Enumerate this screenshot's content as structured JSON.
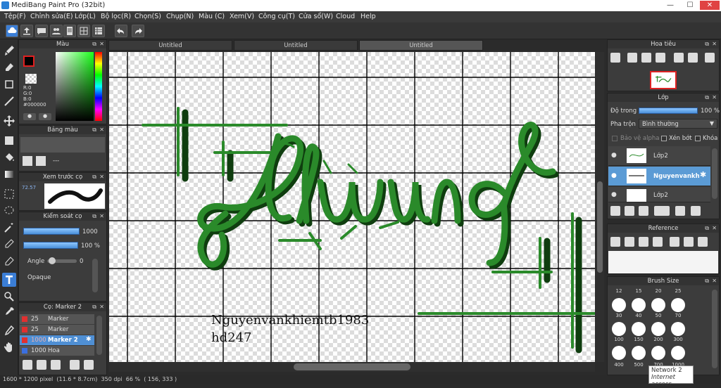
{
  "window": {
    "title": "MediBang Paint Pro (32bit)",
    "min": "—",
    "max": "☐",
    "close": "✕"
  },
  "menu": [
    "Tệp(F)",
    "Chỉnh sửa(E)",
    "Lớp(L)",
    "Bộ lọc(R)",
    "Chọn(S)",
    "Chụp(N)",
    "Màu (C)",
    "Xem(V)",
    "Công cụ(T)",
    "Cửa sổ(W)",
    "Cloud",
    "Help"
  ],
  "tabs": [
    "Untitled",
    "Untitled",
    "Untitled"
  ],
  "color_panel": {
    "title": "Màu",
    "r": "R:0",
    "g": "G:0",
    "b": "B:0",
    "hex": "#000000",
    "primary": "#000000",
    "secondary": "#ffffff"
  },
  "palette_panel": {
    "title": "Bảng màu",
    "empty": "---"
  },
  "preview_panel": {
    "title": "Xem trước cọ",
    "zoom": "72.57"
  },
  "brush_ctrl": {
    "title": "Kiểm soát cọ",
    "width_val": "1000",
    "opacity_val": "100 %",
    "angle_label": "Angle",
    "angle_val": "0",
    "opaque_label": "Opaque"
  },
  "brush_list": {
    "title": "Cọ: Marker 2",
    "items": [
      {
        "size": "25",
        "name": "Marker",
        "color": "#e03030"
      },
      {
        "size": "25",
        "name": "Marker",
        "color": "#e03030"
      },
      {
        "size": "1000",
        "name": "Marker 2",
        "color": "#e03030"
      },
      {
        "size": "1000",
        "name": "Hoa",
        "color": "#3a6fe0"
      }
    ]
  },
  "navigator": {
    "title": "Hoa tiêu"
  },
  "layer_panel": {
    "title": "Lớp",
    "opacity_label": "Độ trong",
    "opacity_val": "100 %",
    "blend_label": "Pha trộn",
    "blend_val": "Bình thường",
    "protect_alpha": "Bảo vệ alpha",
    "clip": "Xén bớt",
    "lock": "Khóa",
    "layers": [
      "Lớp2",
      "Nguyenvankh",
      "Lớp2"
    ]
  },
  "reference": {
    "title": "Reference"
  },
  "brush_size": {
    "title": "Brush Size",
    "top": [
      "12",
      "15",
      "20",
      "25"
    ],
    "row1": [
      "30",
      "40",
      "50",
      "70"
    ],
    "row2": [
      "100",
      "150",
      "200",
      "300"
    ],
    "row3": [
      "400",
      "500",
      "700",
      "1000"
    ]
  },
  "canvas_text": {
    "line1": "Nguyenvankhiemtb1983",
    "line2": "hd247"
  },
  "status": {
    "text": "1600 * 1200 pixel  (11.6 * 8.7cm)  350 dpi  66 %  ( 156, 333 )"
  },
  "tooltip": {
    "line1": "Network  2",
    "line2": "Internet access"
  },
  "colors": {
    "accent": "#3b7ed6",
    "stroke_green": "#2a8a2a",
    "stroke_dark": "#0f3d0f"
  }
}
